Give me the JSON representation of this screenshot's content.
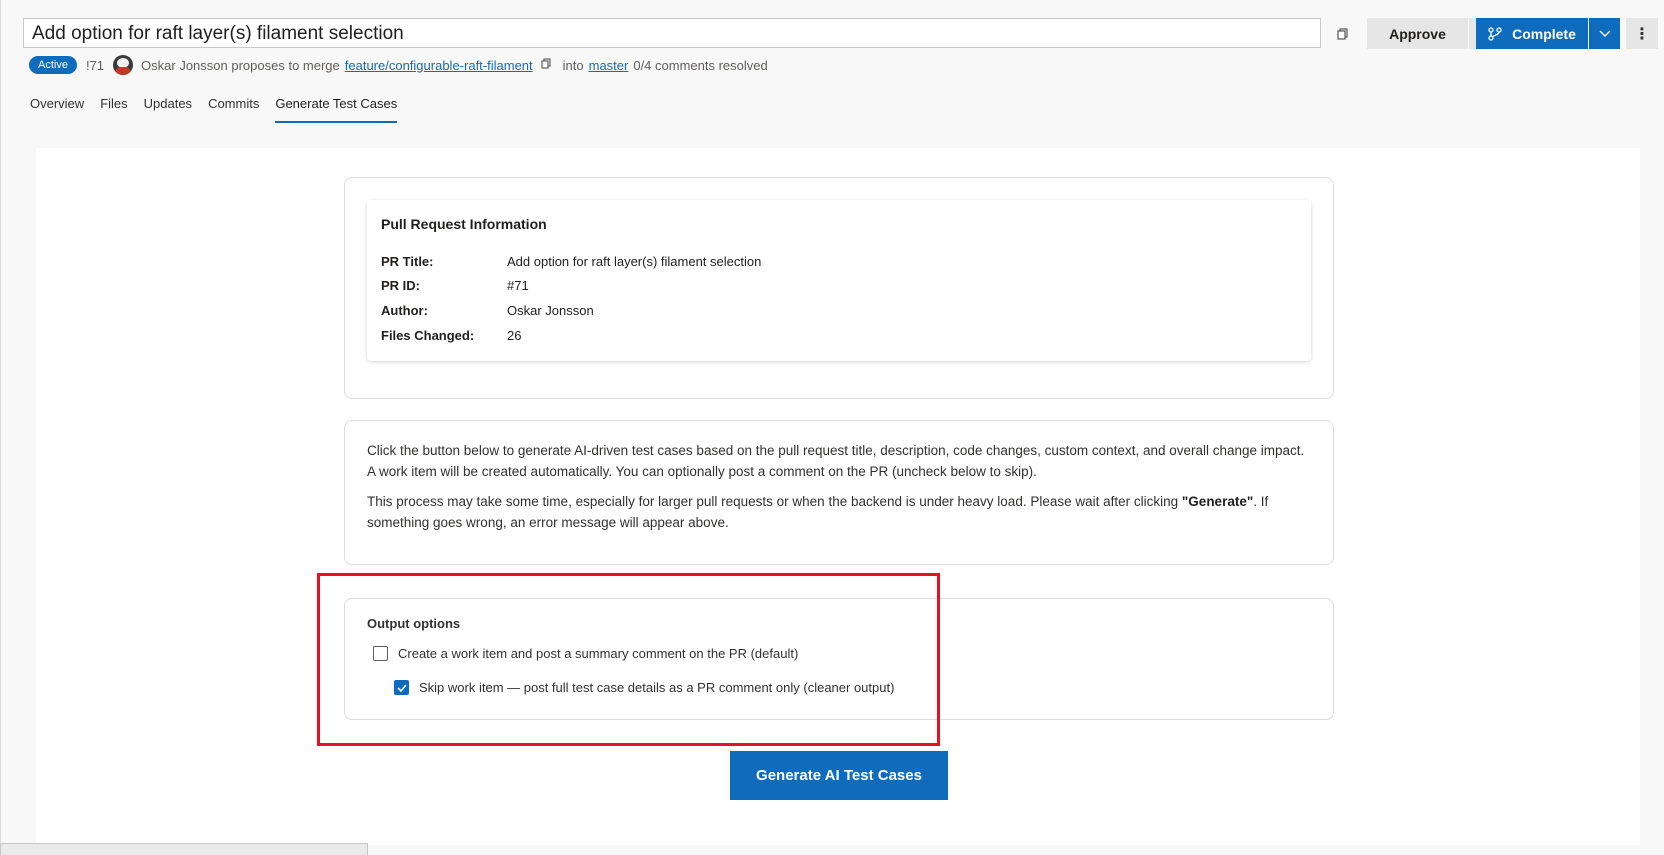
{
  "header": {
    "title": "Add option for raft layer(s) filament selection",
    "approve_label": "Approve",
    "complete_label": "Complete",
    "more_symbol": "⋮"
  },
  "meta": {
    "status_badge": "Active",
    "pr_number": "!71",
    "author_text": "Oskar Jonsson proposes to merge",
    "source_branch": "feature/configurable-raft-filament",
    "into_text": "into",
    "target_branch": "master",
    "comments_resolved": "0/4 comments resolved"
  },
  "tabs": [
    {
      "label": "Overview"
    },
    {
      "label": "Files"
    },
    {
      "label": "Updates"
    },
    {
      "label": "Commits"
    },
    {
      "label": "Generate Test Cases",
      "active": true
    }
  ],
  "pr_info": {
    "heading": "Pull Request Information",
    "rows": [
      {
        "label": "PR Title:",
        "value": "Add option for raft layer(s) filament selection"
      },
      {
        "label": "PR ID:",
        "value": "#71"
      },
      {
        "label": "Author:",
        "value": "Oskar Jonsson"
      },
      {
        "label": "Files Changed:",
        "value": "26"
      }
    ]
  },
  "description": {
    "line1": "Click the button below to generate AI-driven test cases based on the pull request title, description, code changes, custom context, and overall change impact.",
    "line2": "A work item will be created automatically. You can optionally post a comment on the PR (uncheck below to skip).",
    "para2_before": "This process may take some time, especially for larger pull requests or when the backend is under heavy load. Please wait after clicking ",
    "para2_bold": "\"Generate\"",
    "para2_after": ". If",
    "para2_line2": "something goes wrong, an error message will appear above."
  },
  "output_options": {
    "heading": "Output options",
    "option1_label": "Create a work item and post a summary comment on the PR (default)",
    "option1_checked": false,
    "option2_label": "Skip work item — post full test case details as a PR comment only (cleaner output)",
    "option2_checked": true
  },
  "generate_button_label": "Generate AI Test Cases",
  "colors": {
    "accent": "#0f6cbd",
    "highlight": "#e81123"
  }
}
